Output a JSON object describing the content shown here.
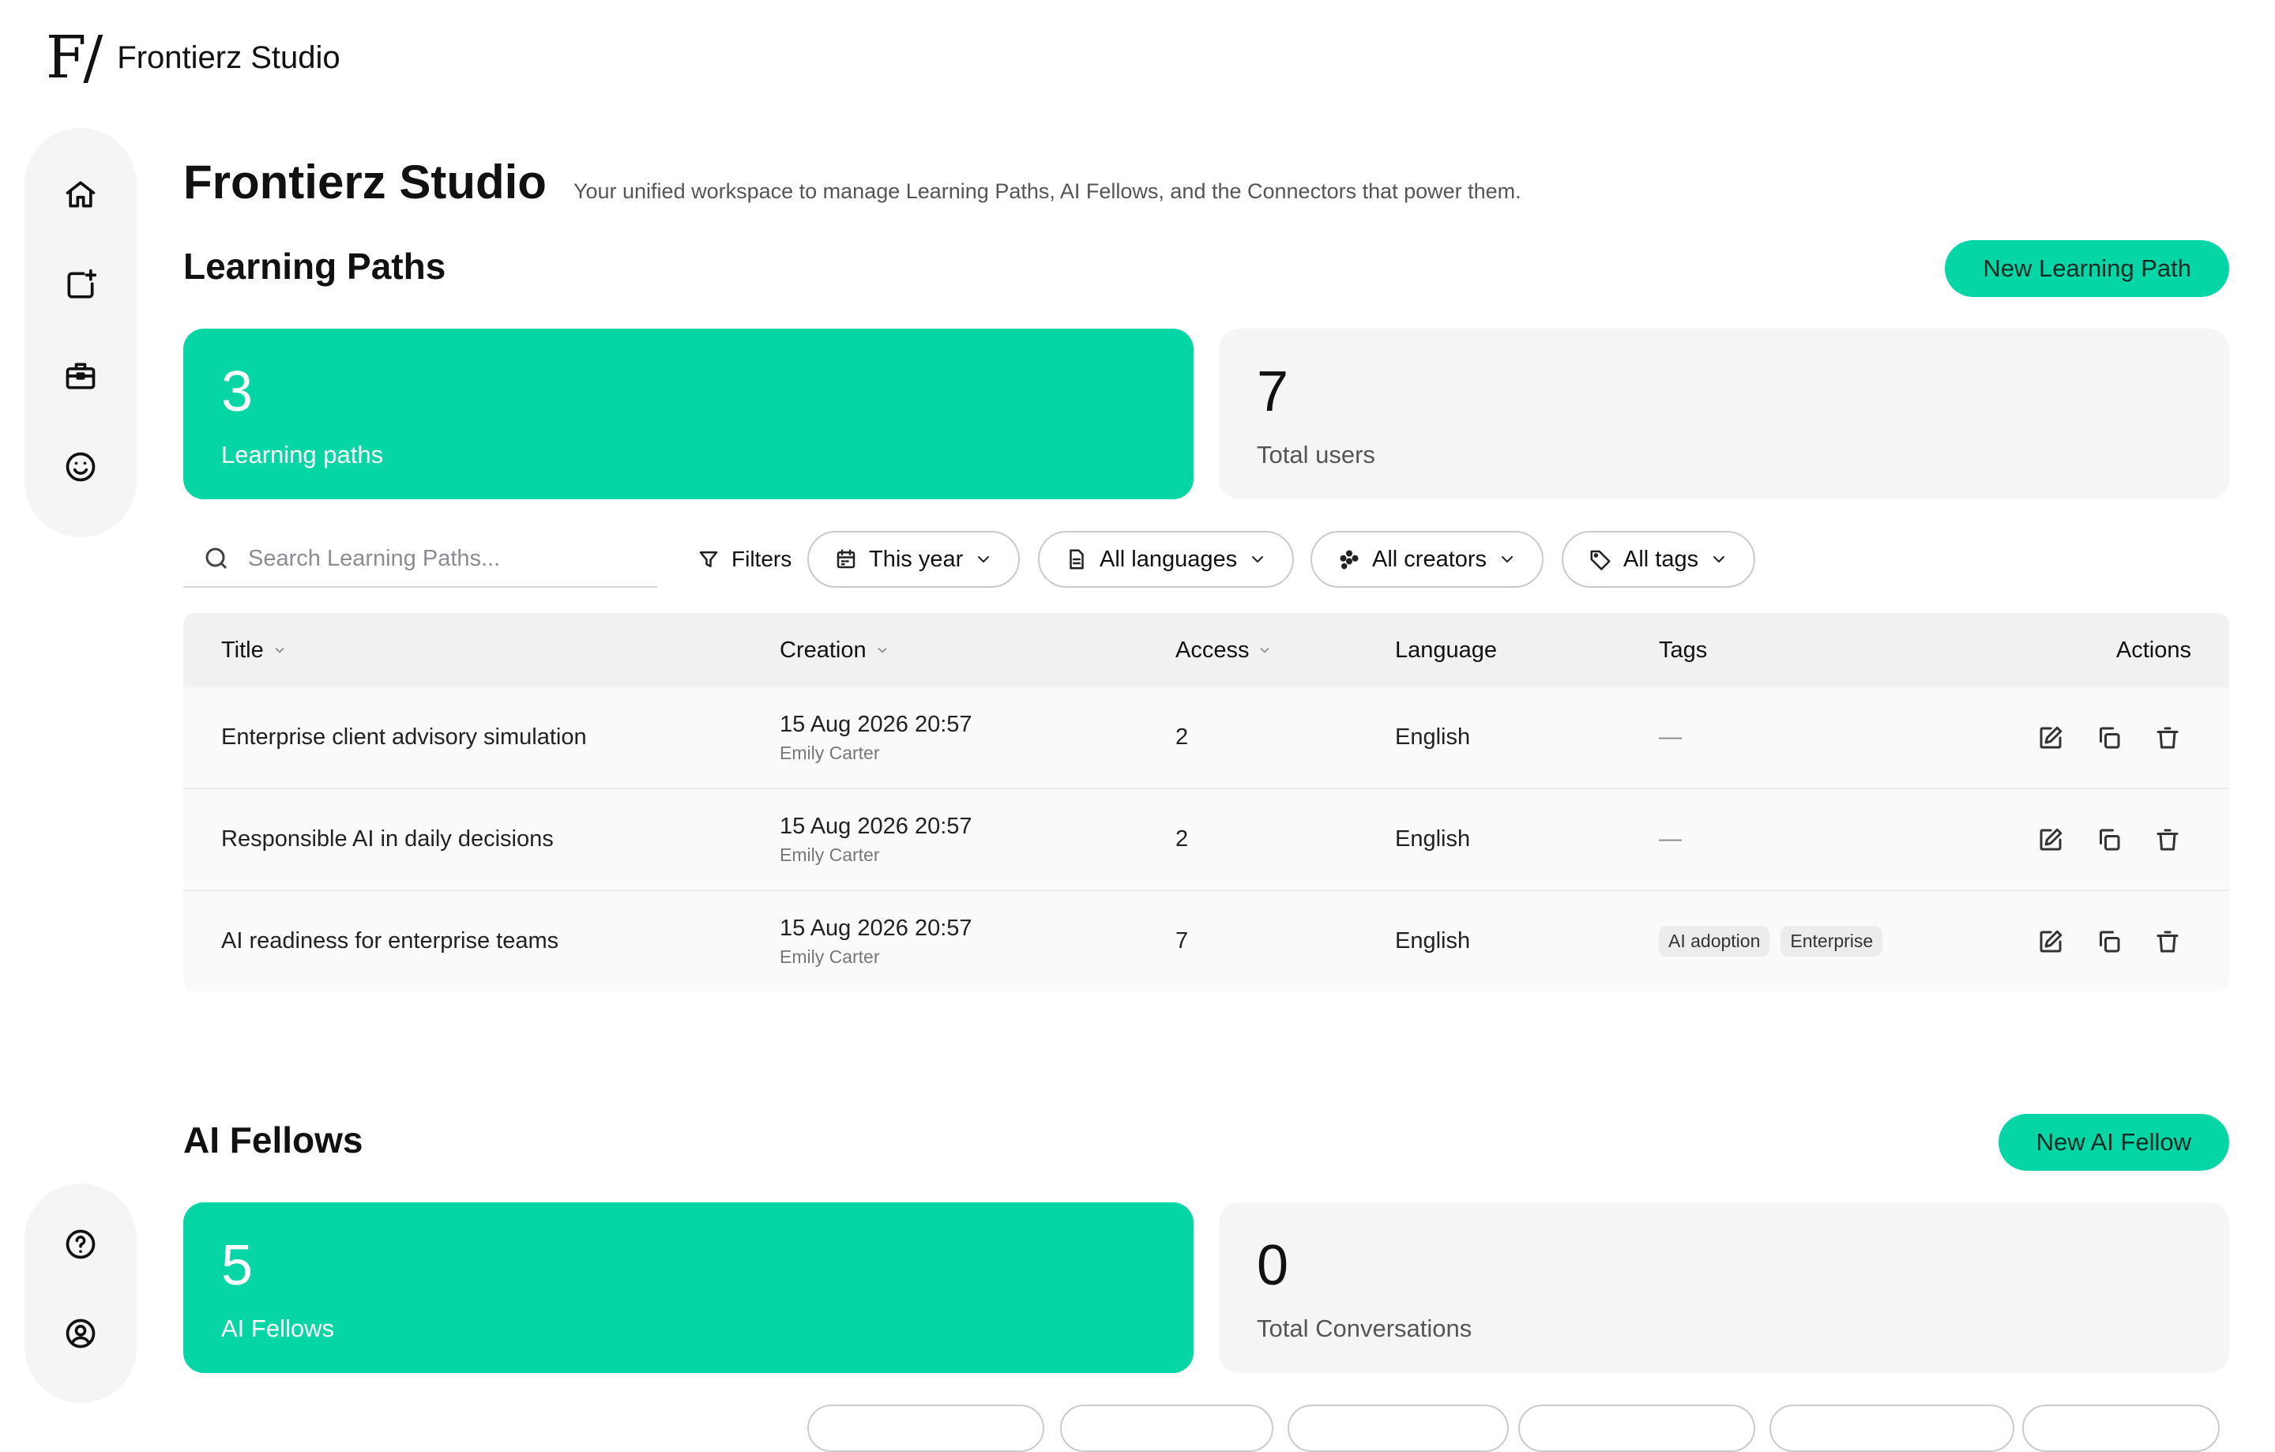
{
  "brand": {
    "logo": "F/",
    "name": "Frontierz Studio"
  },
  "rail_top": [
    {
      "icon": "home-icon"
    },
    {
      "icon": "sparkle-square-icon"
    },
    {
      "icon": "briefcase-icon"
    },
    {
      "icon": "smile-icon"
    }
  ],
  "rail_bottom": [
    {
      "icon": "help-icon"
    },
    {
      "icon": "user-icon"
    }
  ],
  "header": {
    "title": "Frontierz Studio",
    "subtitle": "Your unified workspace to manage Learning Paths, AI Fellows, and the Connectors that power them."
  },
  "learning_paths": {
    "title": "Learning Paths",
    "new_button": "New Learning Path",
    "stats": [
      {
        "value": "3",
        "label": "Learning paths"
      },
      {
        "value": "7",
        "label": "Total users"
      }
    ],
    "search_placeholder": "Search Learning Paths...",
    "filters_label": "Filters",
    "pills": [
      {
        "label": "This year",
        "icon": "calendar-icon"
      },
      {
        "label": "All languages",
        "icon": "document-icon"
      },
      {
        "label": "All creators",
        "icon": "people-icon"
      },
      {
        "label": "All tags",
        "icon": "tag-icon"
      }
    ],
    "columns": {
      "title": "Title",
      "creation": "Creation",
      "access": "Access",
      "language": "Language",
      "tags": "Tags",
      "actions": "Actions"
    },
    "rows": [
      {
        "title": "Enterprise client advisory simulation",
        "date": "15 Aug 2026 20:57",
        "creator": "Emily Carter",
        "access": "2",
        "language": "English",
        "tags": [],
        "no_tags": "—"
      },
      {
        "title": "Responsible AI in daily decisions",
        "date": "15 Aug 2026 20:57",
        "creator": "Emily Carter",
        "access": "2",
        "language": "English",
        "tags": [],
        "no_tags": "—"
      },
      {
        "title": "AI readiness for enterprise teams",
        "date": "15 Aug 2026 20:57",
        "creator": "Emily Carter",
        "access": "7",
        "language": "English",
        "tags": [
          "AI adoption",
          "Enterprise"
        ],
        "no_tags": ""
      }
    ]
  },
  "ai_fellows": {
    "title": "AI Fellows",
    "new_button": "New AI Fellow",
    "stats": [
      {
        "value": "5",
        "label": "AI Fellows"
      },
      {
        "value": "0",
        "label": "Total Conversations"
      }
    ]
  },
  "colors": {
    "accent": "#06d6a6",
    "surface": "#f4f5f6",
    "text": "#111111"
  }
}
